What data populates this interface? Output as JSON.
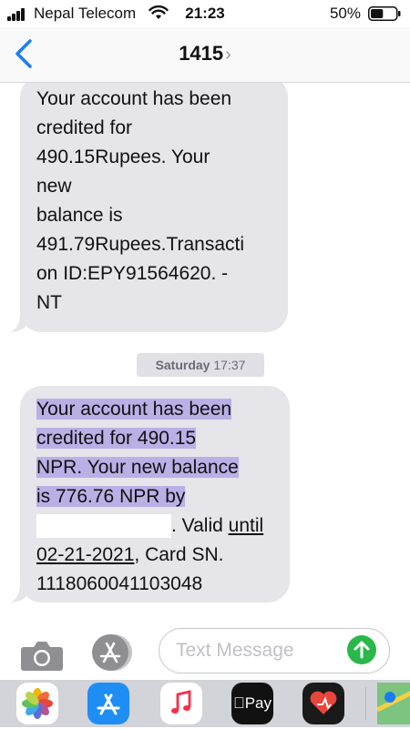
{
  "status_bar": {
    "carrier": "Nepal Telecom",
    "time": "21:23",
    "battery_percent": "50%",
    "battery_level": 0.5
  },
  "header": {
    "contact": "1415",
    "chevron": "›"
  },
  "messages": [
    {
      "lines": [
        "Your account has been",
        "credited for",
        "490.15Rupees. Your",
        "new",
        "balance is",
        "491.79Rupees.Transacti",
        "on ID:EPY91564620. -",
        "NT"
      ]
    },
    {
      "timestamp_day": "Saturday",
      "timestamp_time": "17:37",
      "lines": [
        "Your account has been",
        "credited for 490.15",
        "NPR. Your new balance",
        "is 776.76 NPR by"
      ],
      "line5_suffix": ". Valid ",
      "line5_link": "until",
      "line6_link": "02-21-2021",
      "line6_suffix": ", Card SN.",
      "line7": "1118060041103048"
    }
  ],
  "input": {
    "placeholder": "Text Message"
  },
  "app_drawer": {
    "apple_pay_label": "Pay",
    "icons": [
      "photos-icon",
      "app-store-icon",
      "music-icon",
      "apple-pay-icon",
      "heart-app-icon",
      "maps-icon"
    ]
  },
  "colors": {
    "bubble": "#e5e5ea",
    "accent_blue": "#1a7cf5",
    "send_green": "#2ab84a",
    "highlight": "#bbb0e6"
  }
}
